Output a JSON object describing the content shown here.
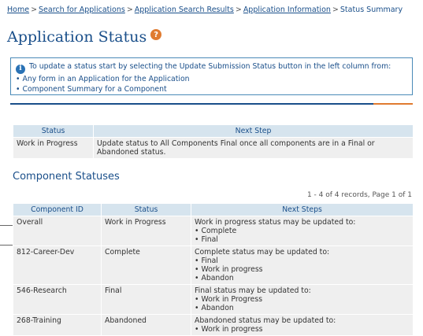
{
  "breadcrumb": {
    "items": [
      "Home",
      "Search for Applications",
      "Application Search Results",
      "Application Information"
    ],
    "current": "Status Summary",
    "separator": ">"
  },
  "page": {
    "title": "Application Status",
    "help_symbol": "?"
  },
  "info_box": {
    "icon_symbol": "i",
    "lead": "To update a status start by selecting the Update Submission Status button in the left column from:",
    "bullets": [
      "Any form in an Application for the Application",
      "Component Summary for a Component"
    ]
  },
  "status_table": {
    "headers": [
      "Status",
      "Next Step"
    ],
    "rows": [
      {
        "status": "Work in Progress",
        "next_step": "Update status to All Components Final once all components are in a Final or Abandoned status."
      }
    ]
  },
  "component_section": {
    "title": "Component Statuses",
    "records_info": "1 - 4 of 4 records, Page 1 of 1",
    "headers": [
      "Component ID",
      "Status",
      "Next Steps"
    ],
    "rows": [
      {
        "id": "Overall",
        "status": "Work in Progress",
        "lead": "Work in progress status may be updated to:",
        "options": [
          "Complete",
          "Final"
        ]
      },
      {
        "id": "812-Career-Dev",
        "status": "Complete",
        "lead": "Complete status may be updated to:",
        "options": [
          "Final",
          "Work in progress",
          "Abandon"
        ]
      },
      {
        "id": "546-Research",
        "status": "Final",
        "lead": "Final status may be updated to:",
        "options": [
          "Work in Progress",
          "Abandon"
        ]
      },
      {
        "id": "268-Training",
        "status": "Abandoned",
        "lead": "Abandoned status may be updated to:",
        "options": [
          "Work in progress"
        ]
      }
    ]
  },
  "colors": {
    "link": "#1a4f8a",
    "header_bg": "#d6e4ee",
    "row_bg": "#efefef",
    "accent_orange": "#e07b30"
  }
}
